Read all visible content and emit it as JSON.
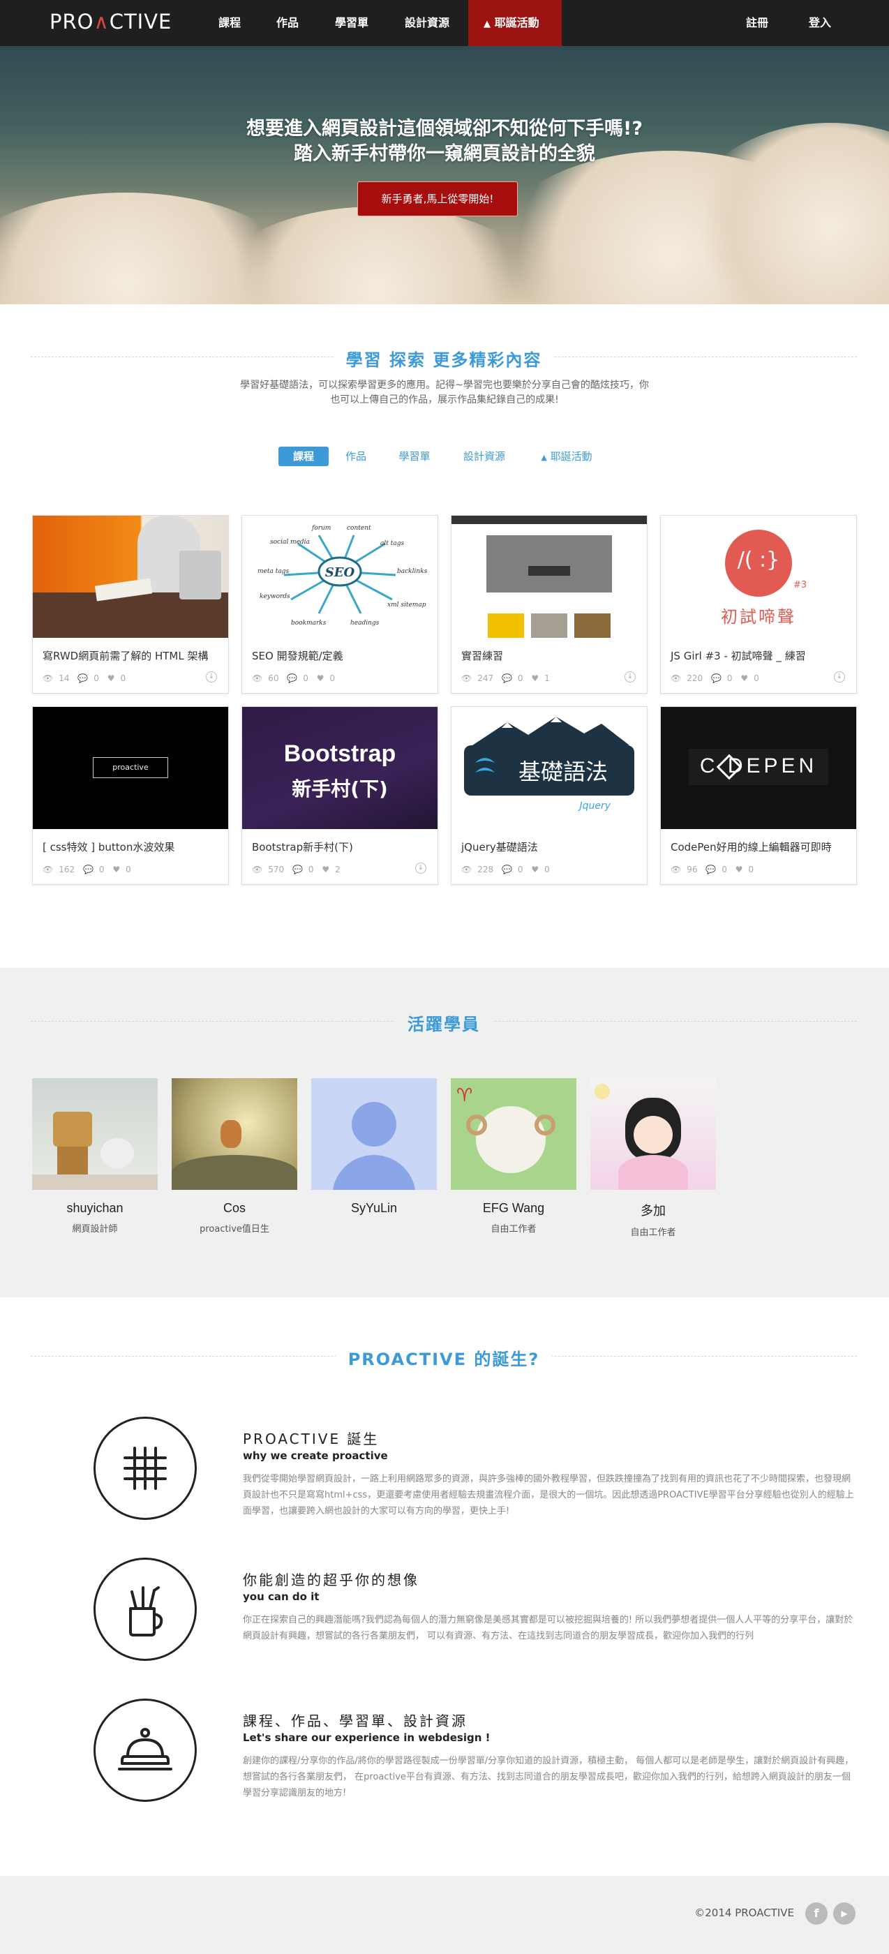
{
  "nav": {
    "logo": "PROACTIVE",
    "items": [
      "課程",
      "作品",
      "學習單",
      "設計資源",
      "耶誕活動"
    ],
    "register": "註冊",
    "login": "登入"
  },
  "hero": {
    "title_line1": "想要進入網頁設計這個領域卻不知從何下手嗎!?",
    "title_line2": "踏入新手村帶你一窺網頁設計的全貌",
    "cta": "新手勇者,馬上從零開始!"
  },
  "explore": {
    "heading": "學習 探索 更多精彩內容",
    "intro_line1": "學習好基礎語法，可以探索學習更多的應用。記得~學習完也要樂於分享自己會的酷炫技巧，你",
    "intro_line2": "也可以上傳自己的作品，展示作品集紀錄自己的成果!"
  },
  "tabs": [
    "課程",
    "作品",
    "學習單",
    "設計資源",
    "耶誕活動"
  ],
  "cards": [
    {
      "title": "寫RWD網頁前需了解的 HTML 架構",
      "views": "14",
      "comments": "0",
      "likes": "0"
    },
    {
      "title": "SEO 開發規範/定義",
      "views": "60",
      "comments": "0",
      "likes": "0"
    },
    {
      "title": "實習練習",
      "views": "247",
      "comments": "0",
      "likes": "1"
    },
    {
      "title": "JS Girl #3 - 初試啼聲 _ 練習",
      "views": "220",
      "comments": "0",
      "likes": "0"
    },
    {
      "title": "[ css特效 ] button水波效果",
      "views": "162",
      "comments": "0",
      "likes": "0"
    },
    {
      "title": "Bootstrap新手村(下)",
      "views": "570",
      "comments": "0",
      "likes": "2"
    },
    {
      "title": "jQuery基礎語法",
      "views": "228",
      "comments": "0",
      "likes": "0"
    },
    {
      "title": "CodePen好用的線上編輯器可即時",
      "views": "96",
      "comments": "0",
      "likes": "0"
    }
  ],
  "thumbs": {
    "seo_center": "SEO",
    "seo_words": [
      "social media",
      "forum",
      "content",
      "alt tags",
      "meta tags",
      "backlinks",
      "keywords",
      "xml sitemap",
      "bookmarks",
      "headings"
    ],
    "jsgirl_mark": "/( :}",
    "jsgirl_num": "#3",
    "jsgirl_text": "初試啼聲",
    "proactive_box": "proactive",
    "bootstrap_1": "Bootstrap",
    "bootstrap_2": "新手村(下)",
    "jquery_text": "基礎語法",
    "jquery_sub": "Jquery",
    "codepen": "C  DEPEN"
  },
  "members": {
    "heading": "活躍學員",
    "list": [
      {
        "name": "shuyichan",
        "role": "網頁設計師"
      },
      {
        "name": "Cos",
        "role": "proactive值日生"
      },
      {
        "name": "SyYuLin",
        "role": ""
      },
      {
        "name": "EFG Wang",
        "role": "自由工作者"
      },
      {
        "name": "多加",
        "role": "自由工作者"
      }
    ]
  },
  "about": {
    "heading": "PROACTIVE 的誕生?",
    "features": [
      {
        "title": "PROACTIVE 誕生",
        "subtitle": "why we create proactive",
        "text": "我們從零開始學習網頁設計，一路上利用網路眾多的資源，與許多強棒的國外教程學習，但跌跌撞撞為了找到有用的資訊也花了不少時間探索，也發現網頁設計也不只是寫寫html+css，更還要考慮使用者經驗去規畫流程介面，是很大的一個坑。因此想透過PROACTIVE學習平台分享經驗也從別人的經驗上面學習，也讓要跨入網也設計的大家可以有方向的學習，更快上手!"
      },
      {
        "title": "你能創造的超乎你的想像",
        "subtitle": "you can do it",
        "text": "你正在探索自己的興趣潛能嗎?我們認為每個人的潛力無窮像是美感其實都是可以被挖掘與培養的! 所以我們夢想者提供一個人人平等的分享平台，讓對於網頁設計有興趣，想嘗試的各行各業朋友們， 可以有資源、有方法、在這找到志同道合的朋友學習成長，歡迎你加入我們的行列"
      },
      {
        "title": "課程、作品、學習單、設計資源",
        "subtitle": "Let's share our experience in webdesign !",
        "text": "創建你的課程/分享你的作品/將你的學習路徑製成一份學習單/分享你知道的設計資源，積極主動， 每個人都可以是老師是學生，讓對於網頁設計有興趣，想嘗試的各行各業朋友們， 在proactive平台有資源、有方法、找到志同道合的朋友學習成長吧，歡迎你加入我們的行列，給想跨入網頁設計的朋友一個學習分享認識朋友的地方!"
      }
    ]
  },
  "footer": {
    "copyright": "©2014 PROACTIVE",
    "facebook": "f",
    "youtube": "▶"
  },
  "colors": {
    "accent": "#3d9ad8",
    "nav_bg": "#1f1f1f",
    "nav_active": "#9b1411",
    "cta": "#a80d0d"
  }
}
